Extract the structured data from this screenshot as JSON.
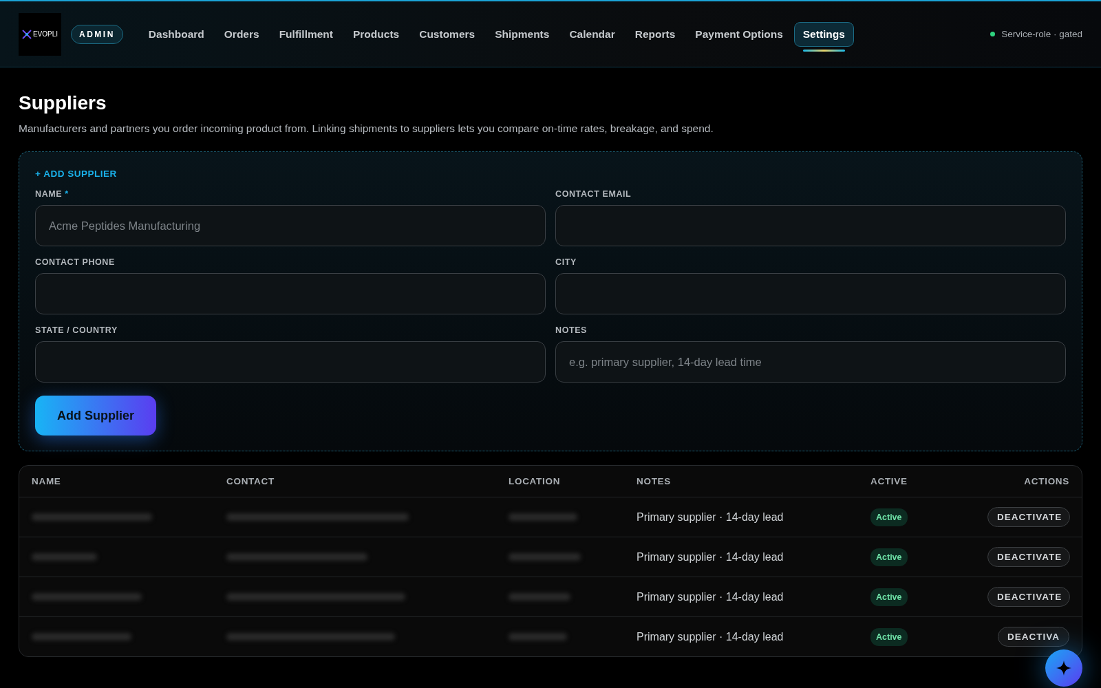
{
  "header": {
    "logo": {
      "wordmark": "EVOPLI"
    },
    "role_badge": "ADMIN",
    "nav": [
      {
        "label": "Dashboard",
        "selected": false
      },
      {
        "label": "Orders",
        "selected": false
      },
      {
        "label": "Fulfillment",
        "selected": false
      },
      {
        "label": "Products",
        "selected": false
      },
      {
        "label": "Customers",
        "selected": false
      },
      {
        "label": "Shipments",
        "selected": false
      },
      {
        "label": "Calendar",
        "selected": false
      },
      {
        "label": "Reports",
        "selected": false
      },
      {
        "label": "Payment Options",
        "selected": false
      },
      {
        "label": "Settings",
        "selected": true
      }
    ],
    "status": "Service-role · gated"
  },
  "page": {
    "title": "Suppliers",
    "description": "Manufacturers and partners you order incoming product from. Linking shipments to suppliers lets you compare on-time rates, breakage, and spend."
  },
  "form": {
    "heading": "+ ADD SUPPLIER",
    "fields": [
      {
        "label": "NAME",
        "required_mark": "*",
        "placeholder": "Acme Peptides Manufacturing"
      },
      {
        "label": "CONTACT EMAIL"
      },
      {
        "label": "CONTACT PHONE"
      },
      {
        "label": "CITY"
      },
      {
        "label": "STATE / COUNTRY"
      },
      {
        "label": "NOTES",
        "placeholder": "e.g. primary supplier, 14-day lead time"
      }
    ],
    "submit": "Add Supplier"
  },
  "table": {
    "columns": [
      "NAME",
      "CONTACT",
      "LOCATION",
      "NOTES",
      "ACTIVE",
      "ACTIONS"
    ],
    "rows": [
      {
        "notes": "Primary supplier · 14-day lead",
        "active": "Active",
        "action": "DEACTIVATE"
      },
      {
        "notes": "Primary supplier · 14-day lead",
        "active": "Active",
        "action": "DEACTIVATE"
      },
      {
        "notes": "Primary supplier · 14-day lead",
        "active": "Active",
        "action": "DEACTIVATE"
      },
      {
        "notes": "Primary supplier · 14-day lead",
        "active": "Active",
        "action": "DEACTIVA"
      }
    ]
  }
}
